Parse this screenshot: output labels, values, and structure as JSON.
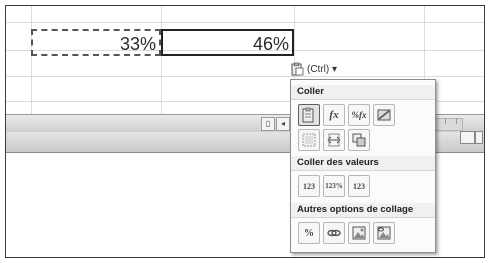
{
  "spreadsheet": {
    "copied_cell_value": "33%",
    "active_cell_value": "46%"
  },
  "smart_tag": {
    "label": "(Ctrl) ▾"
  },
  "paste_menu": {
    "section_coller": "Coller",
    "section_coller_valeurs": "Coller des valeurs",
    "section_autres_options": "Autres options de collage",
    "icons": {
      "paste": "paste-icon",
      "formulas": "fx",
      "formulas_number_format": "%fx",
      "keep_source_formatting": "keep-source-formatting-icon",
      "no_borders": "no-borders-icon",
      "keep_column_widths": "keep-column-widths-icon",
      "transpose": "transpose-icon",
      "values": "123",
      "values_number_format": "123%",
      "values_source_formatting": "123",
      "formatting": "%",
      "paste_link": "paste-link-icon",
      "picture": "picture-icon",
      "linked_picture": "linked-picture-icon"
    }
  }
}
